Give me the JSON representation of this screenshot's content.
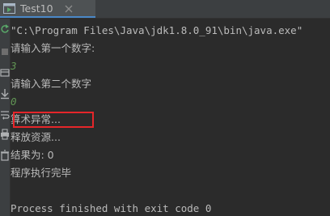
{
  "tab": {
    "title": "Test10",
    "icon": "run-config-icon",
    "close_icon": "close-icon"
  },
  "gutter": {
    "icons": [
      "rerun-icon",
      "stop-icon",
      "scroll-to-end-icon",
      "print-icon",
      "delete-icon"
    ]
  },
  "console": {
    "command": "\"C:\\Program Files\\Java\\jdk1.8.0_91\\bin\\java.exe\"",
    "lines": [
      {
        "text": "请输入第一个数字:",
        "kind": "output"
      },
      {
        "text": "3",
        "kind": "input"
      },
      {
        "text": "请输入第二个数字",
        "kind": "output"
      },
      {
        "text": "0",
        "kind": "input"
      },
      {
        "text": "算术异常...",
        "kind": "output"
      },
      {
        "text": "释放资源...",
        "kind": "output"
      },
      {
        "text": "结果为: 0",
        "kind": "output"
      },
      {
        "text": "程序执行完毕",
        "kind": "output"
      },
      {
        "text": "",
        "kind": "blank"
      },
      {
        "text": "Process finished with exit code 0",
        "kind": "output"
      }
    ]
  },
  "colors": {
    "background": "#2b2b2b",
    "text": "#bbbbbb",
    "user_input": "#629755",
    "highlight_border": "#e5262a",
    "tab_underline": "#4a88c7"
  }
}
